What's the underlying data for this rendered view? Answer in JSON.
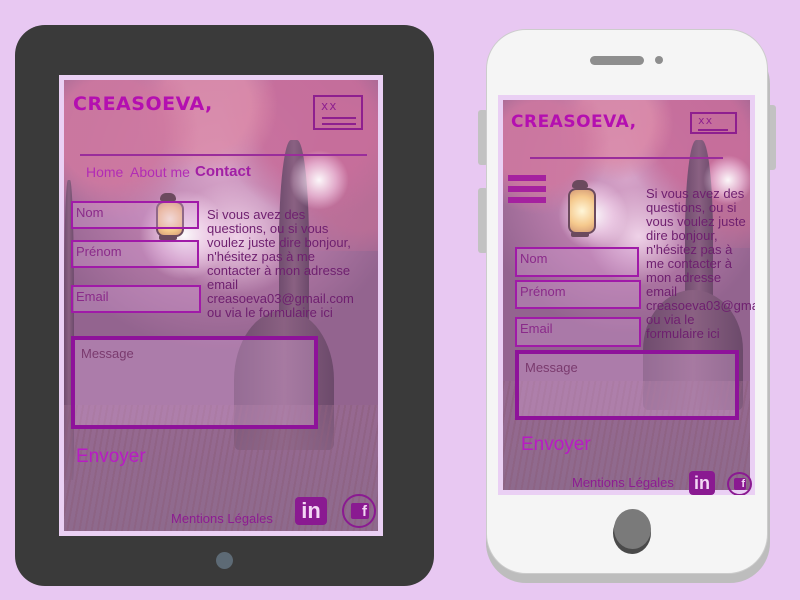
{
  "brand": "CREASOEVA,",
  "logo": {
    "mark": "xx",
    "icon": "signature-logo"
  },
  "nav": {
    "home": "Home",
    "about": "About me",
    "contact": "Contact"
  },
  "form": {
    "nom": "Nom",
    "prenom": "Prénom",
    "email": "Email",
    "message": "Message",
    "send": "Envoyer"
  },
  "intro": "Si vous avez des questions,  ou si vous voulez juste dire bonjour, n'hésitez pas à me contacter à mon adresse email creasoeva03@gmail.com ou via le formulaire ici",
  "footer": {
    "legal": "Mentions Légales",
    "linkedin": "in",
    "facebook": "f"
  },
  "colors": {
    "accent": "#b40fb0",
    "field_border": "#a01aa8",
    "background": "#e8c8f2"
  }
}
